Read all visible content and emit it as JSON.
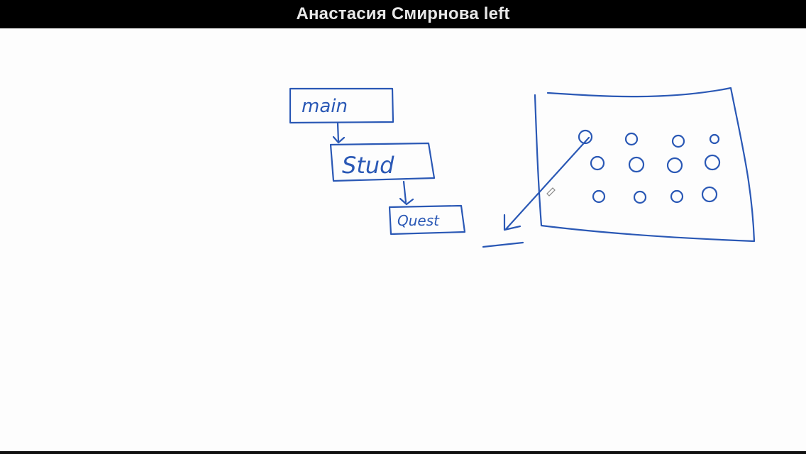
{
  "banner": {
    "participant_status": "Анастасия Смирнова left"
  },
  "whiteboard": {
    "ink_color": "#2a58b5",
    "boxes": [
      {
        "id": "main",
        "label": "main"
      },
      {
        "id": "stud",
        "label": "Stud"
      },
      {
        "id": "quest",
        "label": "Quest"
      }
    ]
  }
}
